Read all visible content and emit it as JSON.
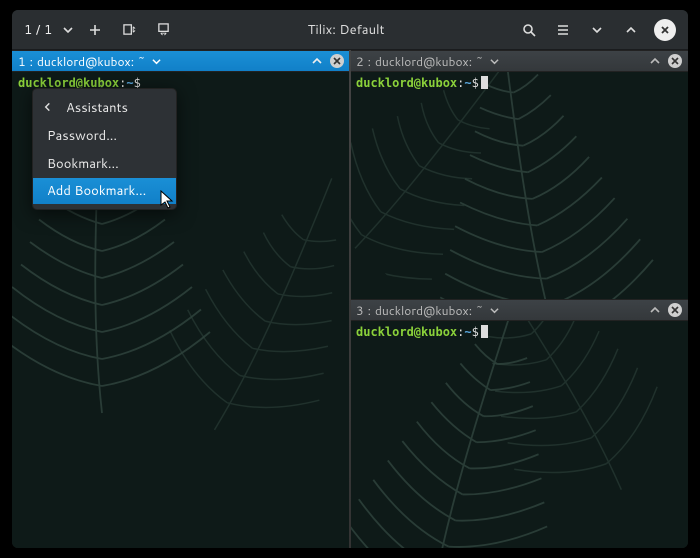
{
  "window": {
    "title": "Tilix: Default",
    "session_counter": "1 / 1"
  },
  "panes": [
    {
      "index": "1",
      "title": "ducklord@kubox: ~",
      "active": true,
      "prompt": {
        "user": "ducklord",
        "host": "kubox",
        "path": "~",
        "symbol": "$"
      }
    },
    {
      "index": "2",
      "title": "ducklord@kubox: ~",
      "active": false,
      "prompt": {
        "user": "ducklord",
        "host": "kubox",
        "path": "~",
        "symbol": "$"
      }
    },
    {
      "index": "3",
      "title": "ducklord@kubox: ~",
      "active": false,
      "prompt": {
        "user": "ducklord",
        "host": "kubox",
        "path": "~",
        "symbol": "$"
      }
    }
  ],
  "menu": {
    "header": "Assistants",
    "items": [
      "Password...",
      "Bookmark...",
      "Add Bookmark..."
    ],
    "highlighted": 2
  }
}
